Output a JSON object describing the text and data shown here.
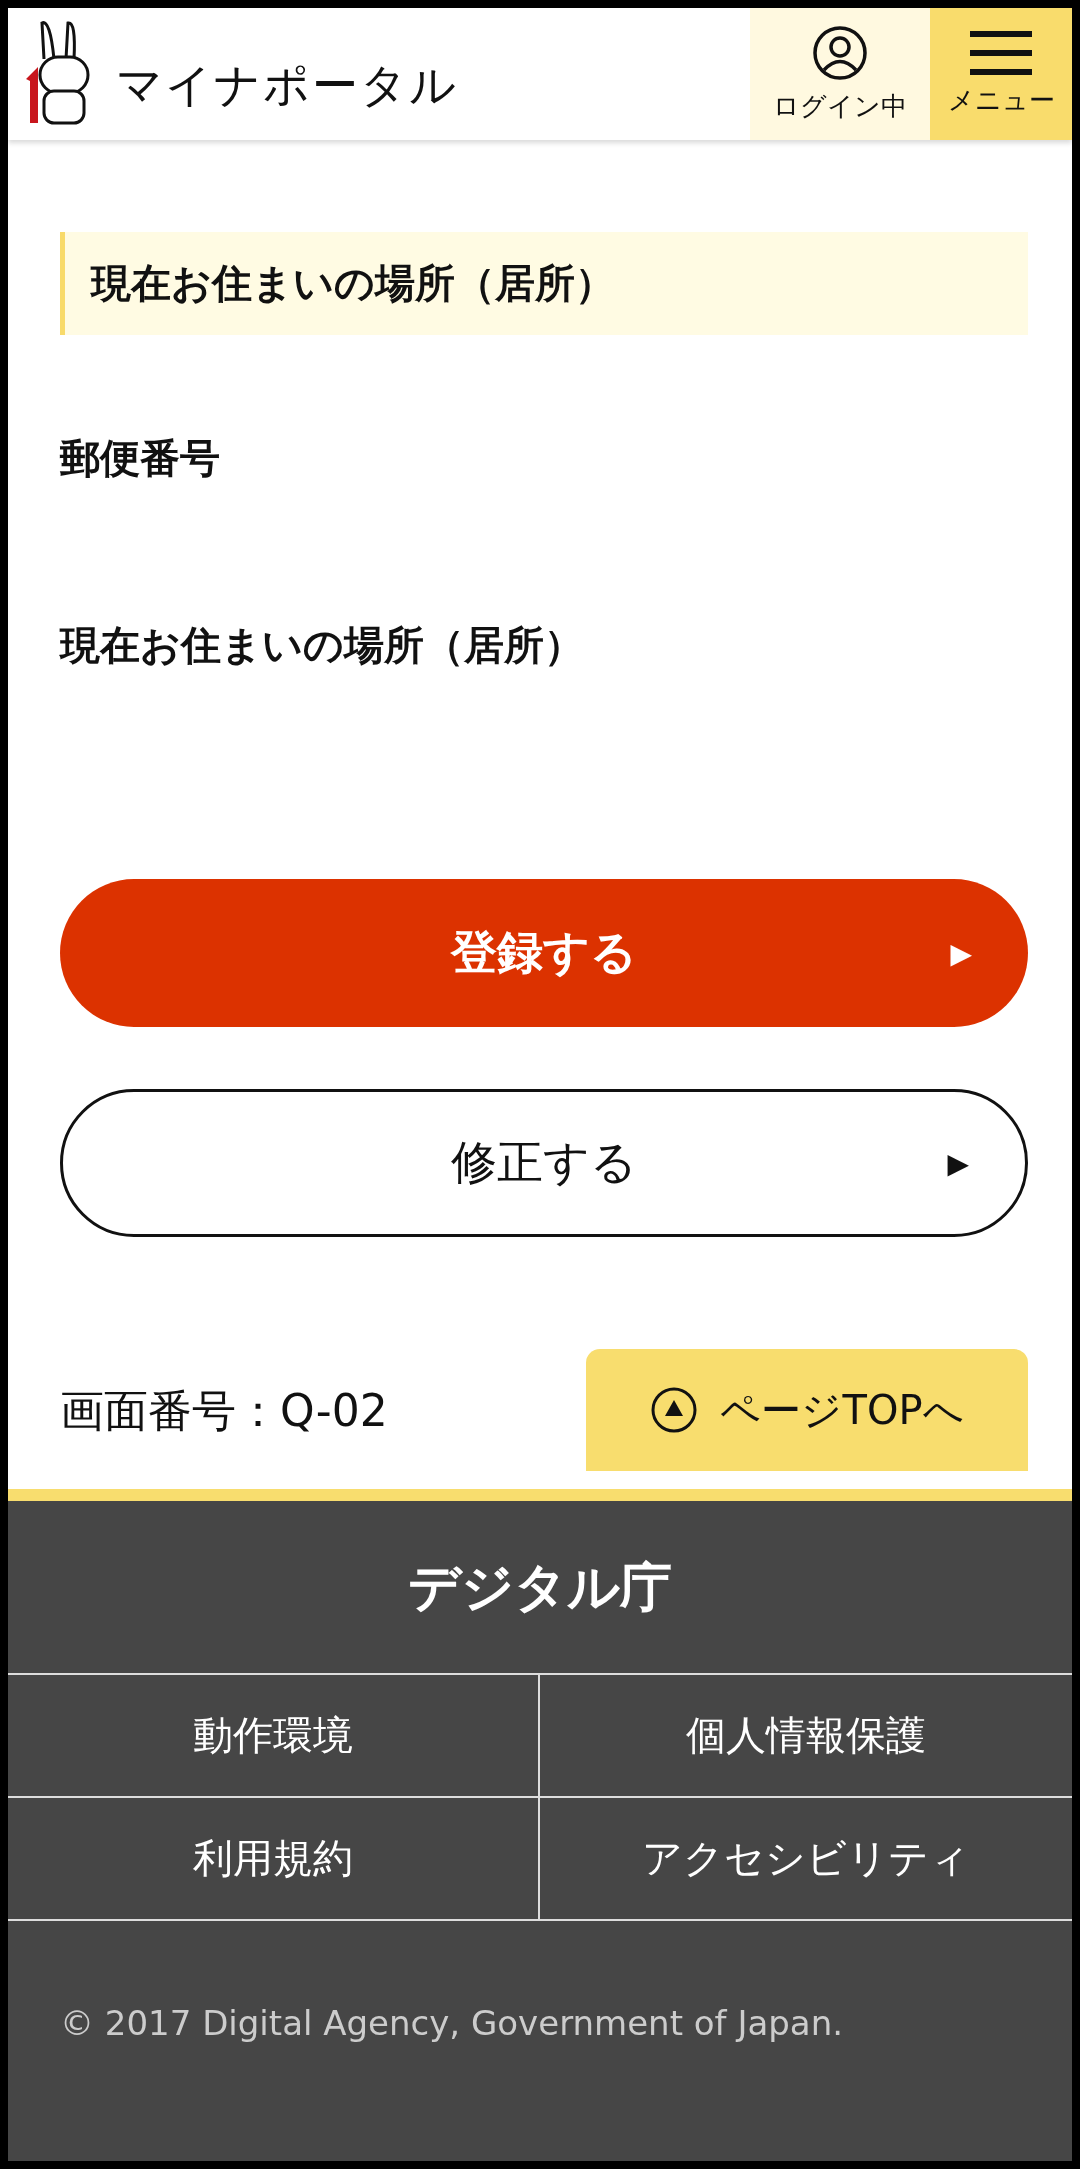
{
  "header": {
    "logo_text": "マイナポータル",
    "login": {
      "label": "ログイン中"
    },
    "menu": {
      "label": "メニュー"
    }
  },
  "section": {
    "heading": "現在お住まいの場所（居所）",
    "fields": [
      {
        "label": "郵便番号"
      },
      {
        "label": "現在お住まいの場所（居所）"
      }
    ]
  },
  "buttons": [
    {
      "label": "登録する",
      "kind": "primary",
      "arrow": "▶"
    },
    {
      "label": "修正する",
      "kind": "secondary",
      "arrow": "▶"
    }
  ],
  "screen_number": "画面番号：Q-02",
  "page_top": {
    "label": "ページTOPへ"
  },
  "footer": {
    "agency": "デジタル庁",
    "links": [
      {
        "label": "動作環境"
      },
      {
        "label": "個人情報保護"
      },
      {
        "label": "利用規約"
      },
      {
        "label": "アクセシビリティ"
      }
    ],
    "copyright": "© 2017 Digital Agency, Government of Japan."
  }
}
